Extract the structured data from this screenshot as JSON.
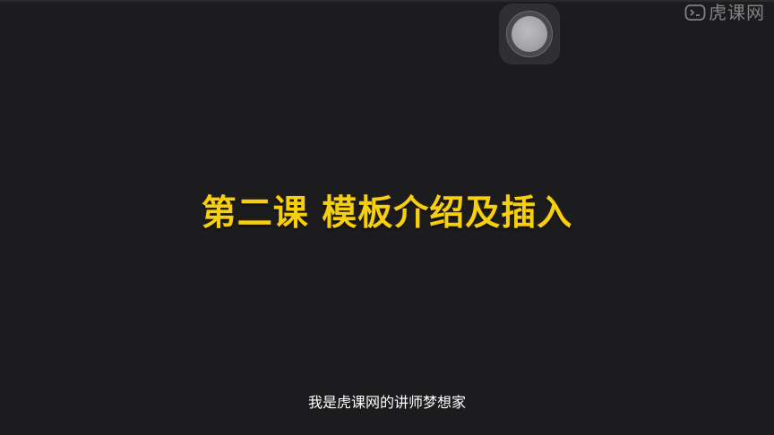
{
  "watermark": {
    "brand": "虎课网",
    "icon": "tiger-logo-icon"
  },
  "floating_button": {
    "icon": "assistive-touch-icon"
  },
  "slide": {
    "title": "第二课 模板介绍及插入",
    "title_color": "#f6cf10"
  },
  "subtitle": {
    "text": "我是虎课网的讲师梦想家"
  },
  "colors": {
    "background": "#1c1b1d",
    "caption": "#ffffff"
  }
}
